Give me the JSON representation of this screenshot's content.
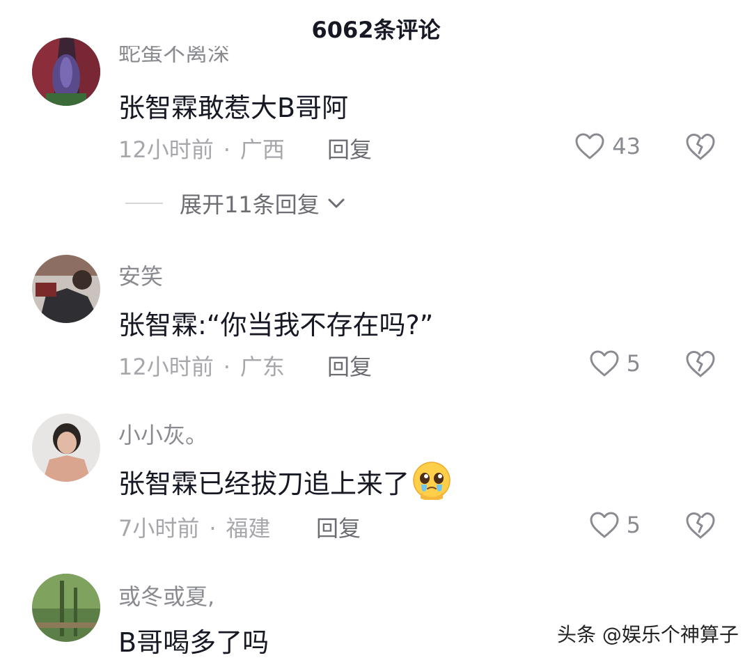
{
  "header": {
    "title": "6062条评论"
  },
  "comments": [
    {
      "username": "蛇蛋不离深",
      "text": "张智霖敢惹大B哥阿",
      "time": "12小时前",
      "dot": "·",
      "location": "广西",
      "reply_label": "回复",
      "likes": "43"
    },
    {
      "username": "安笑",
      "text": "张智霖:“你当我不存在吗?”",
      "time": "12小时前",
      "dot": "·",
      "location": "广东",
      "reply_label": "回复",
      "likes": "5"
    },
    {
      "username": "小小灰。",
      "text": "张智霖已经拔刀追上来了",
      "time": "7小时前",
      "dot": "·",
      "location": "福建",
      "reply_label": "回复",
      "likes": "5",
      "emoji": "pleading-face-emoji"
    },
    {
      "username": "或冬或夏,",
      "text": "B哥喝多了吗"
    }
  ],
  "expand_replies": {
    "label": "展开11条回复"
  },
  "watermark": "头条 @娱乐个神算子",
  "colors": {
    "primary_text": "#161823",
    "secondary_text": "#8a8b91",
    "meta_text": "#a6a7ab"
  },
  "icons": [
    "heart-outline-icon",
    "broken-heart-icon",
    "chevron-down-icon"
  ]
}
